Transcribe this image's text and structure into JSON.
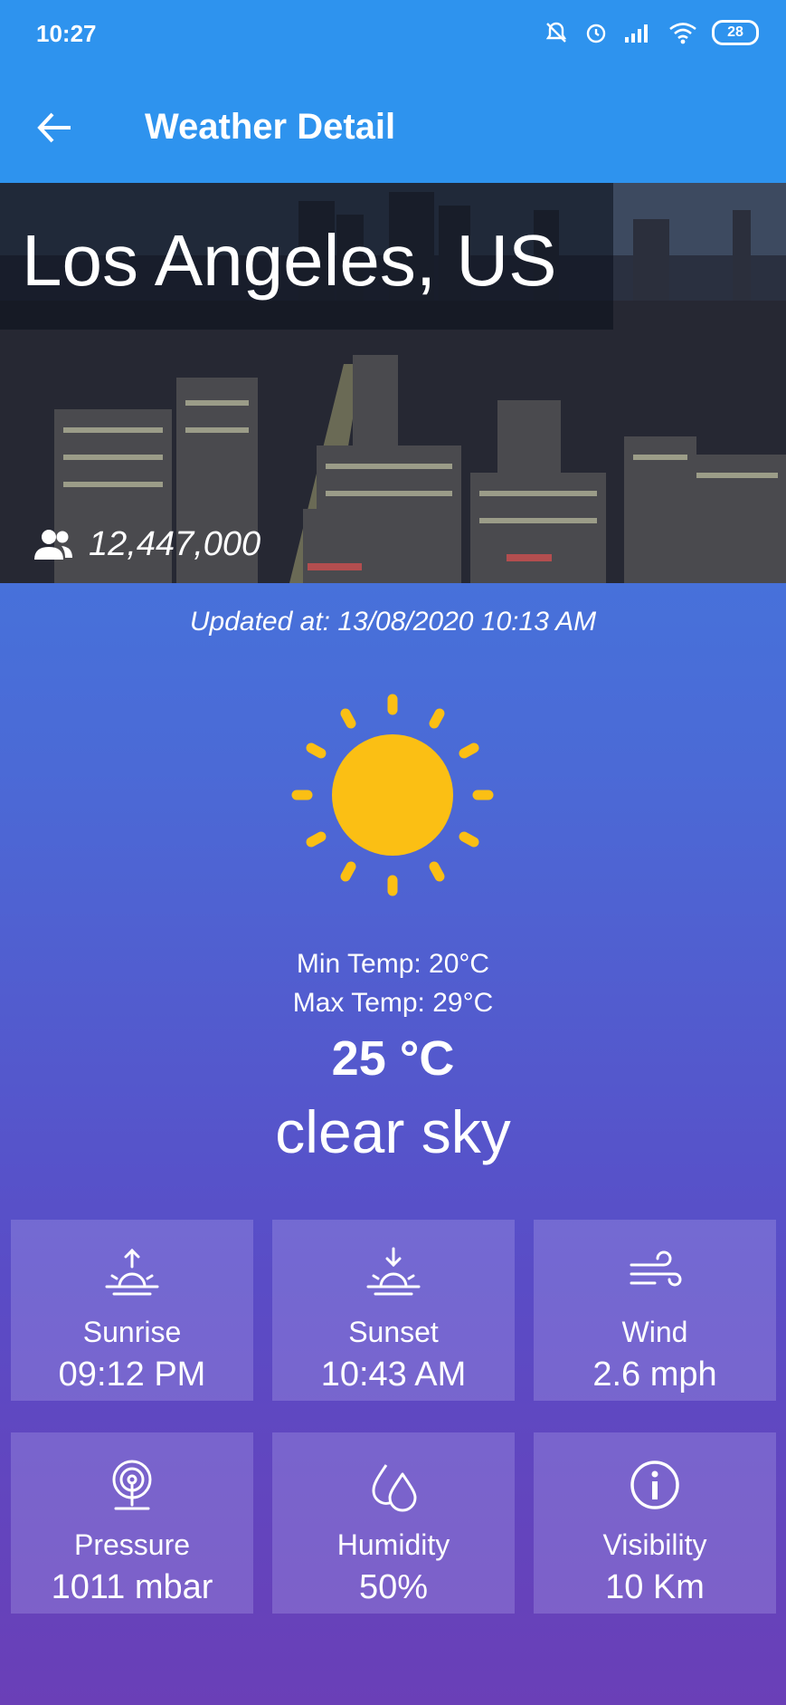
{
  "status_bar": {
    "time": "10:27",
    "battery": "28"
  },
  "app_bar": {
    "title": "Weather Detail"
  },
  "city": {
    "name": "Los Angeles, US",
    "population": "12,447,000"
  },
  "updated_at": "Updated at: 13/08/2020 10:13 AM",
  "weather": {
    "icon": "sun-icon",
    "min_temp": "Min Temp: 20°C",
    "max_temp": "Max Temp: 29°C",
    "temp": "25 °C",
    "description": "clear sky"
  },
  "details": [
    {
      "icon": "sunrise-icon",
      "label": "Sunrise",
      "value": "09:12 PM"
    },
    {
      "icon": "sunset-icon",
      "label": "Sunset",
      "value": "10:43 AM"
    },
    {
      "icon": "wind-icon",
      "label": "Wind",
      "value": "2.6 mph"
    },
    {
      "icon": "pressure-icon",
      "label": "Pressure",
      "value": "1011 mbar"
    },
    {
      "icon": "humidity-icon",
      "label": "Humidity",
      "value": "50%"
    },
    {
      "icon": "info-icon",
      "label": "Visibility",
      "value": "10 Km"
    }
  ],
  "colors": {
    "app_bar": "#2e93ee",
    "sun": "#fbbf14"
  }
}
